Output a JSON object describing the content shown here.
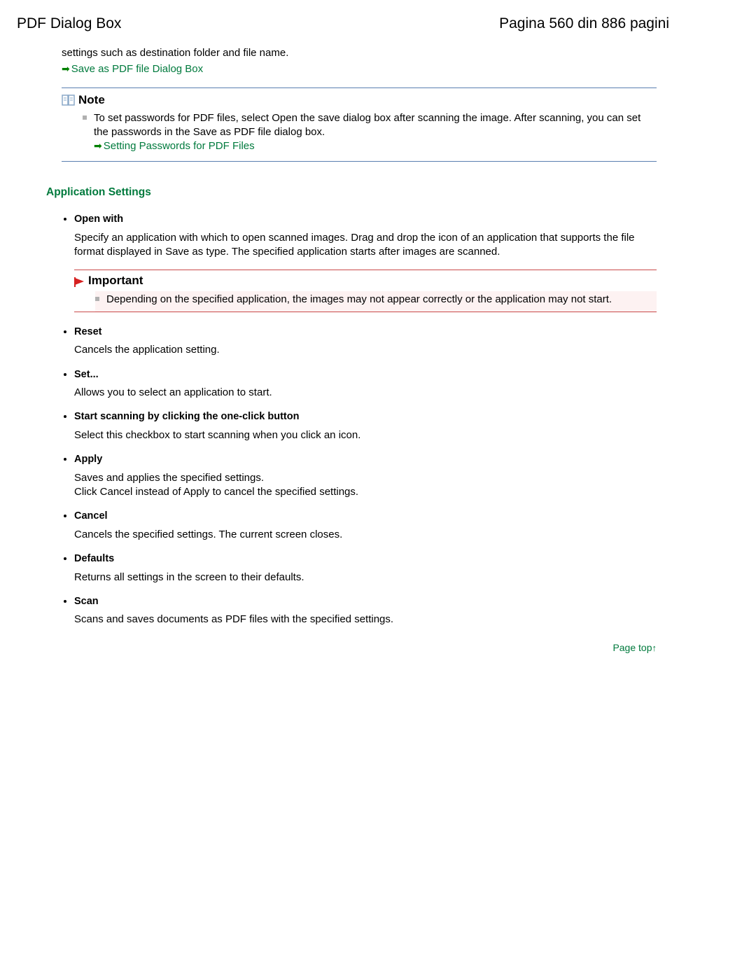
{
  "header": {
    "title_left": "PDF Dialog Box",
    "title_right": "Pagina 560 din 886 pagini"
  },
  "intro": {
    "line": "settings such as destination folder and file name.",
    "link": "Save as PDF file Dialog Box"
  },
  "note": {
    "label": "Note",
    "text": "To set passwords for PDF files, select Open the save dialog box after scanning the image. After scanning, you can set the passwords in the Save as PDF file dialog box.",
    "link": "Setting Passwords for PDF Files"
  },
  "app_settings": {
    "heading": "Application Settings",
    "open_with": {
      "title": "Open with",
      "desc": "Specify an application with which to open scanned images. Drag and drop the icon of an application that supports the file format displayed in Save as type. The specified application starts after images are scanned."
    },
    "important": {
      "label": "Important",
      "text": "Depending on the specified application, the images may not appear correctly or the application may not start."
    },
    "reset": {
      "title": "Reset",
      "desc": "Cancels the application setting."
    },
    "set": {
      "title": "Set...",
      "desc": "Allows you to select an application to start."
    },
    "start_scan": {
      "title": "Start scanning by clicking the one-click button",
      "desc": "Select this checkbox to start scanning when you click an icon."
    },
    "apply": {
      "title": "Apply",
      "desc1": "Saves and applies the specified settings.",
      "desc2": "Click Cancel instead of Apply to cancel the specified settings."
    },
    "cancel": {
      "title": "Cancel",
      "desc": "Cancels the specified settings. The current screen closes."
    },
    "defaults": {
      "title": "Defaults",
      "desc": "Returns all settings in the screen to their defaults."
    },
    "scan": {
      "title": "Scan",
      "desc": "Scans and saves documents as PDF files with the specified settings."
    }
  },
  "page_top": "Page top"
}
